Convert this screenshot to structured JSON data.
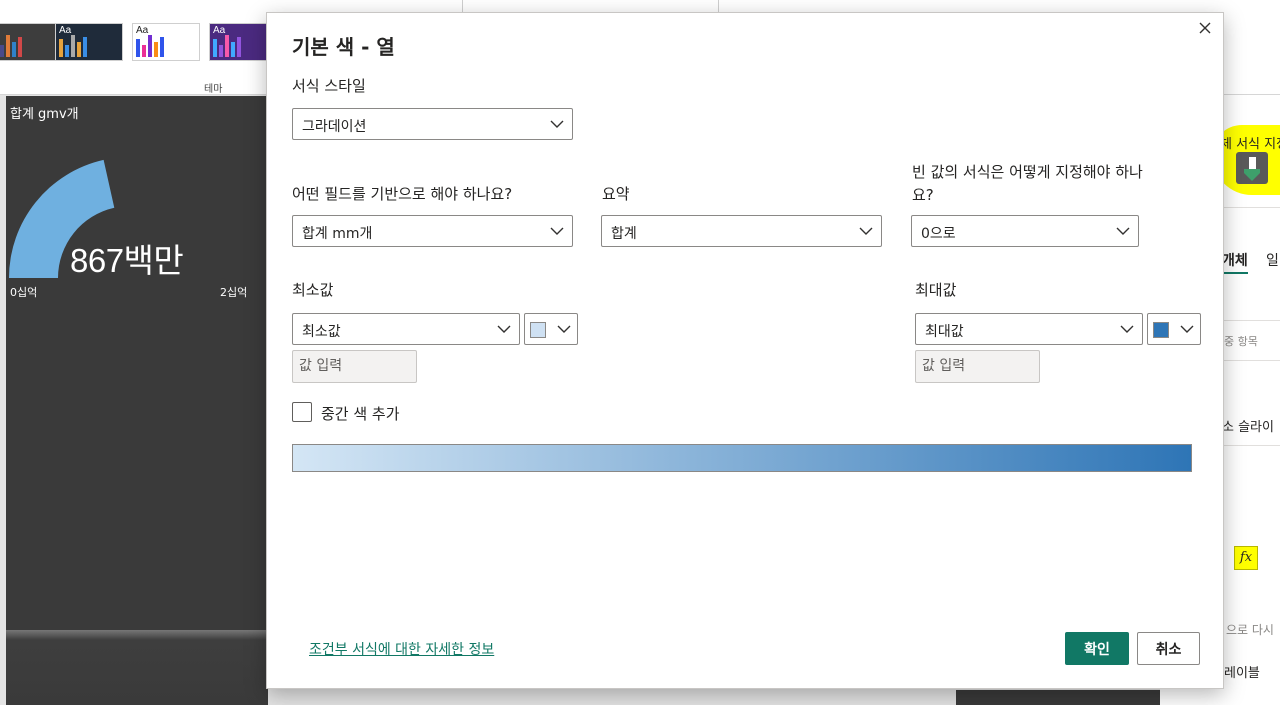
{
  "background": {
    "ribbon": {
      "theme_label": "테마"
    },
    "theme_thumbs": [
      {
        "text": "",
        "bg": "#3d3d3d",
        "bars": [
          "#2f82c9",
          "#4a4a8a",
          "#e07b39",
          "#2f82c9",
          "#d14848"
        ]
      },
      {
        "text": "Aa",
        "bg": "#1f2b3a",
        "bars": [
          "#e6a23c",
          "#3a8ee6",
          "#a9a9a9",
          "#e6a23c",
          "#3a8ee6"
        ]
      },
      {
        "text": "Aa",
        "bg": "#ffffff",
        "bars": [
          "#2f54eb",
          "#eb2f96",
          "#722ed1",
          "#fa8c16",
          "#2f54eb"
        ]
      },
      {
        "text": "Aa",
        "bg": "#4b2a80",
        "bars": [
          "#40a9ff",
          "#9254de",
          "#f759ab",
          "#40a9ff",
          "#9254de"
        ]
      }
    ],
    "visual": {
      "title": "합계 gmv개",
      "value": "867백만",
      "min_label": "0십억",
      "max_label": "2십억",
      "fill_fraction": 0.43,
      "fill_color": "#6fb0e0"
    },
    "right_panel": {
      "header_text": "체 서식 지정",
      "tab_visual": "개체",
      "tab_general": "일",
      "item1": "중 항목",
      "item2": "소 슬라이",
      "item3": "으로 다시",
      "item4": "레이블",
      "fx": "fx"
    }
  },
  "dialog": {
    "title": "기본 색 - 열",
    "format_style_label": "서식 스타일",
    "format_style_value": "그라데이션",
    "field_question": "어떤 필드를 기반으로 해야 하나요?",
    "field_value": "합계 mm개",
    "summary_label": "요약",
    "summary_value": "합계",
    "empty_question_line1": "빈 값의 서식은 어떻게 지정해야 하나",
    "empty_question_line2": "요?",
    "empty_value": "0으로",
    "min_label": "최소값",
    "min_dropdown": "최소값",
    "min_color": "#cfe1f3",
    "min_input_placeholder": "값 입력",
    "max_label": "최대값",
    "max_dropdown": "최대값",
    "max_color": "#2e75b6",
    "max_input_placeholder": "값 입력",
    "middle_checkbox_label": "중간 색 추가",
    "middle_checked": false,
    "gradient_start": "#d4e6f5",
    "gradient_end": "#2e75b6",
    "link_text": "조건부 서식에 대한 자세한 정보",
    "ok_label": "확인",
    "cancel_label": "취소",
    "accent_color": "#117865"
  }
}
